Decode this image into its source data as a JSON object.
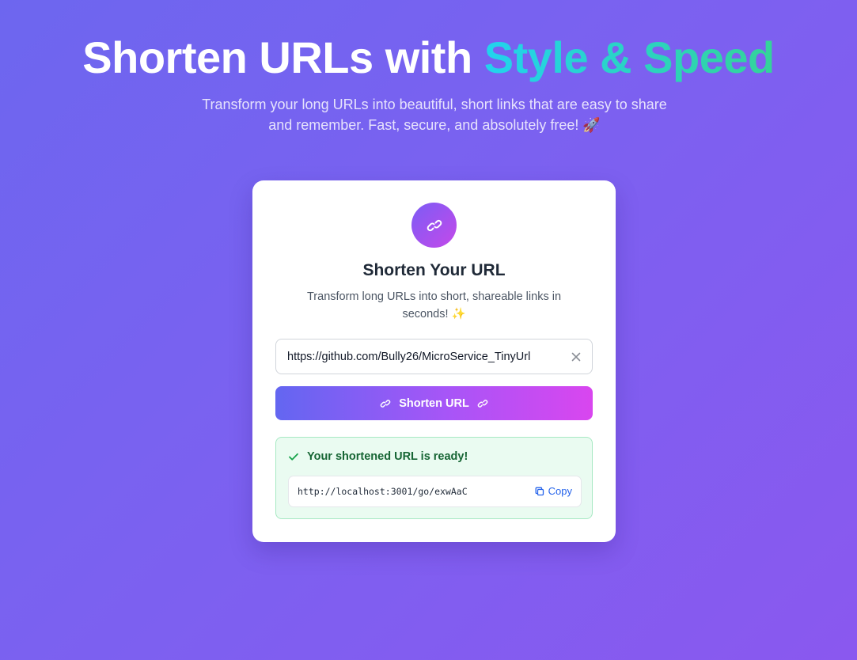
{
  "hero": {
    "title_main": "Shorten URLs with ",
    "title_accent": "Style & Speed",
    "subtitle": "Transform your long URLs into beautiful, short links that are easy to share and remember. Fast, secure, and absolutely free! 🚀"
  },
  "card": {
    "logo_icon": "link-icon",
    "title": "Shorten Your URL",
    "subtitle": "Transform long URLs into short, shareable links in seconds! ✨",
    "url_input": {
      "value": "https://github.com/Bully26/MicroService_TinyUrl",
      "clear_icon": "close-icon"
    },
    "shorten_button": {
      "label": "Shorten URL",
      "icon": "link-icon"
    },
    "result": {
      "heading": "Your shortened URL is ready!",
      "check_icon": "check-icon",
      "short_url": "http://localhost:3001/go/exwAaC",
      "copy_label": "Copy",
      "copy_icon": "copy-icon"
    }
  },
  "colors": {
    "background_start": "#6d66ef",
    "background_end": "#8a58ef",
    "accent_gradient_start": "#22d3ee",
    "accent_gradient_end": "#34d399",
    "button_gradient_start": "#6366f1",
    "button_gradient_end": "#d946ef",
    "success_text": "#166534",
    "success_bg": "#eafbf1",
    "link_blue": "#2563eb"
  }
}
